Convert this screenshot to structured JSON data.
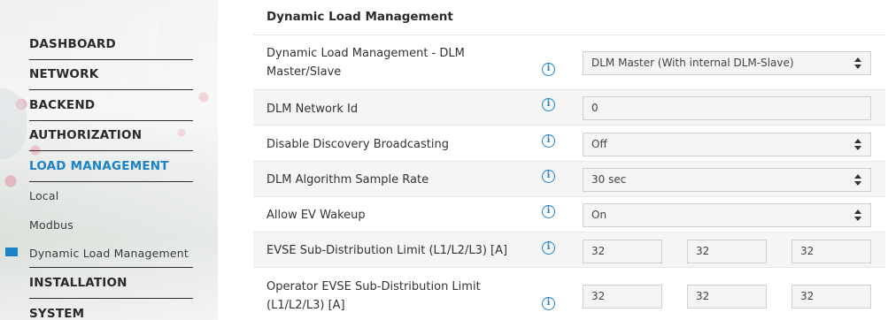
{
  "sidebar": {
    "items": [
      {
        "label": "DASHBOARD"
      },
      {
        "label": "NETWORK"
      },
      {
        "label": "BACKEND"
      },
      {
        "label": "AUTHORIZATION"
      },
      {
        "label": "LOAD MANAGEMENT"
      },
      {
        "label": "Local"
      },
      {
        "label": "Modbus"
      },
      {
        "label": "Dynamic Load Management"
      },
      {
        "label": "INSTALLATION"
      },
      {
        "label": "SYSTEM"
      }
    ]
  },
  "main": {
    "section_title": "Dynamic Load Management",
    "rows": [
      {
        "label_line1": "Dynamic Load Management - DLM",
        "label_line2": "Master/Slave",
        "value": "DLM Master (With internal DLM-Slave)"
      },
      {
        "label": "DLM Network Id",
        "value": "0"
      },
      {
        "label": "Disable Discovery Broadcasting",
        "value": "Off"
      },
      {
        "label": "DLM Algorithm Sample Rate",
        "value": "30 sec"
      },
      {
        "label": "Allow EV Wakeup",
        "value": "On"
      },
      {
        "label": "EVSE Sub-Distribution Limit (L1/L2/L3) [A]",
        "values": [
          "32",
          "32",
          "32"
        ]
      },
      {
        "label_line1": "Operator EVSE Sub-Distribution Limit",
        "label_line2": "(L1/L2/L3) [A]",
        "values": [
          "32",
          "32",
          "32"
        ]
      }
    ],
    "info_glyph": "i"
  },
  "colors": {
    "accent": "#1d82c6",
    "text": "#333333",
    "row_alt": "#f5f5f5",
    "field_bg": "#f4f4f4"
  },
  "icons": {
    "info": "info-circle-icon",
    "select_arrows": "sort-arrows-icon"
  }
}
